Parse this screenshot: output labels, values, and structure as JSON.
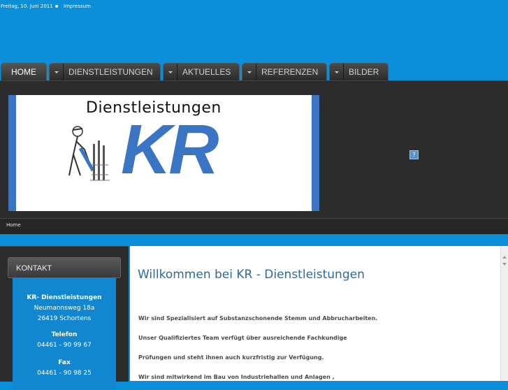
{
  "topbar": {
    "date": "Freitag, 10. Juni 2011",
    "impressum": "Impressum"
  },
  "nav": {
    "home": "HOME",
    "dienstleistungen": "DIENSTLEISTUNGEN",
    "aktuelles": "AKTUELLES",
    "referenzen": "REFERENZEN",
    "bilder": "BILDER"
  },
  "logo": {
    "title": "Dienstleistungen",
    "brand": "KR"
  },
  "breadcrumb": {
    "home": "Home"
  },
  "sidebar": {
    "heading": "KONTAKT",
    "company": "KR- Dienstleistungen",
    "street": "Neumannsweg 18a",
    "city": "26419 Schortens",
    "phone_label": "Telefon",
    "phone": "04461 - 90 99 67",
    "fax_label": "Fax",
    "fax": "04461 - 90 98 25"
  },
  "main": {
    "heading": "Willkommen bei KR - Dienstleistungen",
    "para1": "Wir sind Spezialisiert auf Substanzschonende Stemm und Abbrucharbeiten.",
    "para2": "Unser Qualifiziertes Team verfügt über ausreichende Fachkundige",
    "para3": "Prüfungen und steht ihnen auch kurzfristig zur Verfügung.",
    "para4": "Wir sind mitwirkend im Bau von Industriehallen und Anlagen ,"
  },
  "colors": {
    "background": "#0a8fd8",
    "brand": "#3a75c3",
    "heading": "#2a6c9c"
  }
}
